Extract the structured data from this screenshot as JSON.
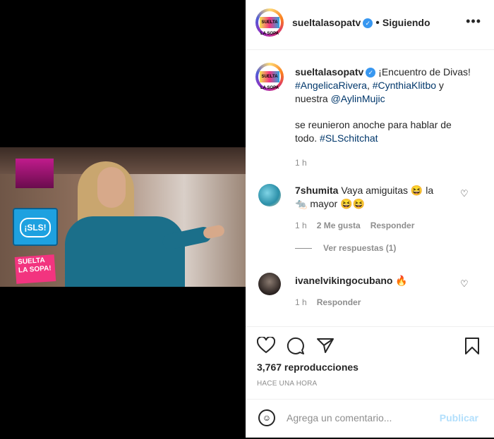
{
  "post": {
    "username": "sueltalasopatv",
    "verified": "✓",
    "following_label": "Siguiendo",
    "more_label": "•••",
    "avatar_text": "SUELTA LA SOPA",
    "video_logo_text": "SUELTA LA SOPA!",
    "video_bubble_text": "¡SLS!"
  },
  "caption": {
    "username": "sueltalasopatv",
    "verified": "✓",
    "line1": "¡Encuentro de Divas!",
    "tag1": "#AngelicaRivera",
    "sep": ", ",
    "tag2": "#CynthiaKlitbo",
    "line2_suffix": " y",
    "line3_prefix": "nuestra ",
    "mention": "@AylinMujic",
    "line4": "se reunieron anoche para hablar de",
    "line5_prefix": "todo. ",
    "tag3": "#SLSchitchat",
    "time": "1 h"
  },
  "comments": [
    {
      "username": "7shumita",
      "text_line1": "Vaya amiguitas 😆 la",
      "text_line2": "🐀 mayor 😆😆",
      "time": "1 h",
      "likes": "2 Me gusta",
      "reply": "Responder",
      "view_replies": "Ver respuestas (1)"
    },
    {
      "username": "ivanelvikingocubano",
      "text": "🔥",
      "time": "1 h",
      "reply": "Responder"
    }
  ],
  "actions": {
    "views": "3,767 reproducciones",
    "timestamp": "HACE UNA HORA",
    "comment_placeholder": "Agrega un comentario...",
    "publish": "Publicar"
  },
  "colors": {
    "link": "#00376b",
    "verified": "#3897f0",
    "muted": "#8e8e8e",
    "publish_disabled": "#b2dffc"
  }
}
